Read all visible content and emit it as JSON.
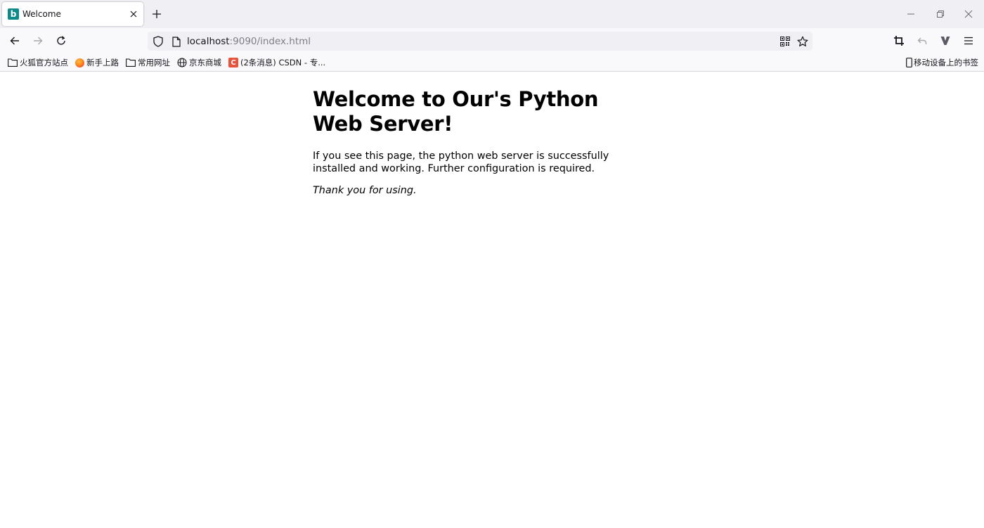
{
  "tab": {
    "title": "Welcome",
    "favicon_letter": "b"
  },
  "navbar": {
    "url_host": "localhost",
    "url_rest": ":9090/index.html"
  },
  "bookmarks": {
    "items": [
      {
        "label": "火狐官方站点",
        "icon": "folder-icon"
      },
      {
        "label": "新手上路",
        "icon": "firefox-icon"
      },
      {
        "label": "常用网址",
        "icon": "folder-icon"
      },
      {
        "label": "京东商城",
        "icon": "globe-icon"
      },
      {
        "label": "(2条消息) CSDN - 专...",
        "icon": "csdn-icon",
        "icon_letter": "C"
      }
    ],
    "mobile": {
      "label": "移动设备上的书签",
      "icon": "mobile-icon"
    }
  },
  "page": {
    "heading": "Welcome to Our's Python Web Server!",
    "paragraph": "If you see this page, the python web server is successfully installed and working. Further configuration is required.",
    "thanks": "Thank you for using."
  },
  "colors": {
    "tabstrip_bg": "#f0f0f4",
    "navbar_bg": "#f9f9fb",
    "favicon_bg": "#0e8a8a",
    "csdn_red": "#e8533b"
  }
}
